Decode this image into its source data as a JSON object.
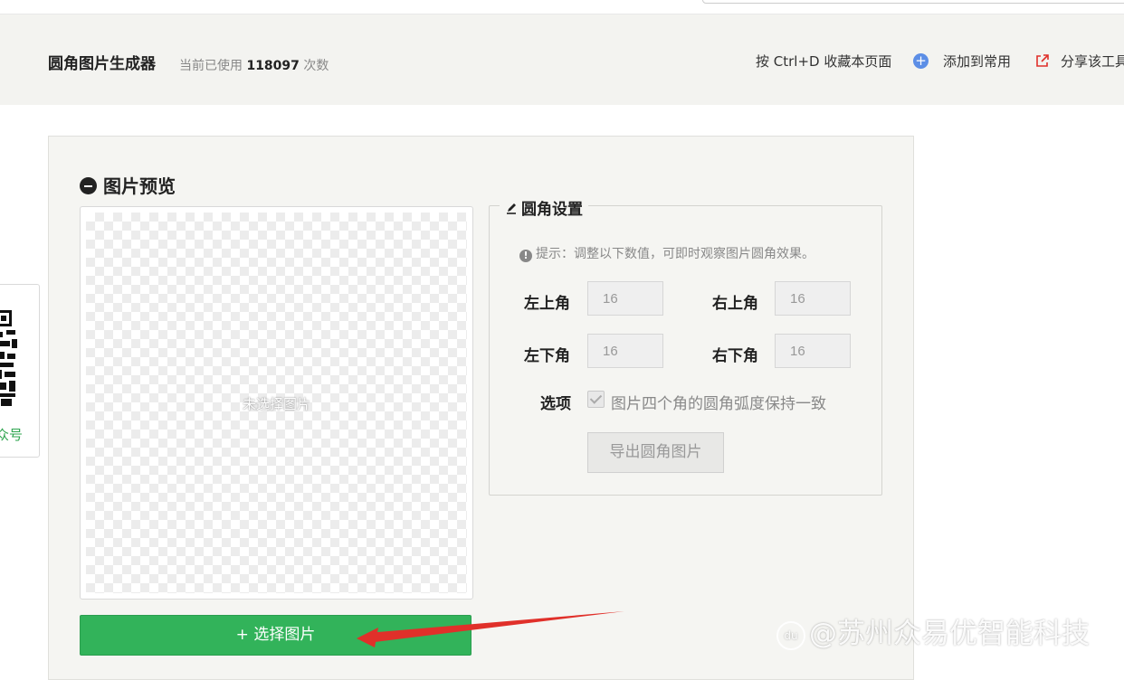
{
  "header": {
    "title": "圆角图片生成器",
    "usage_prefix": "当前已使用",
    "usage_count": "118097",
    "usage_suffix": "次数",
    "bookmark_text": "按 Ctrl+D 收藏本页面",
    "add_common": "添加到常用",
    "share": "分享该工具"
  },
  "side": {
    "qr_label": "众号"
  },
  "preview": {
    "section_title": "图片预览",
    "empty_text": "未选择图片",
    "select_button": "+ 选择图片"
  },
  "settings": {
    "legend": "圆角设置",
    "hint": "提示：调整以下数值，可即时观察图片圆角效果。",
    "top_left_label": "左上角",
    "top_left_value": "16",
    "top_right_label": "右上角",
    "top_right_value": "16",
    "bottom_left_label": "左下角",
    "bottom_left_value": "16",
    "bottom_right_label": "右下角",
    "bottom_right_value": "16",
    "option_label": "选项",
    "option_checkbox_text": "图片四个角的圆角弧度保持一致",
    "option_checked": true,
    "export_button": "导出圆角图片"
  },
  "watermark": {
    "text": "@苏州众易优智能科技",
    "logo": "du"
  },
  "colors": {
    "accent_green": "#32b35a",
    "arrow_red": "#e0302a",
    "plus_blue": "#5c8ee6",
    "share_red": "#e0302a"
  }
}
